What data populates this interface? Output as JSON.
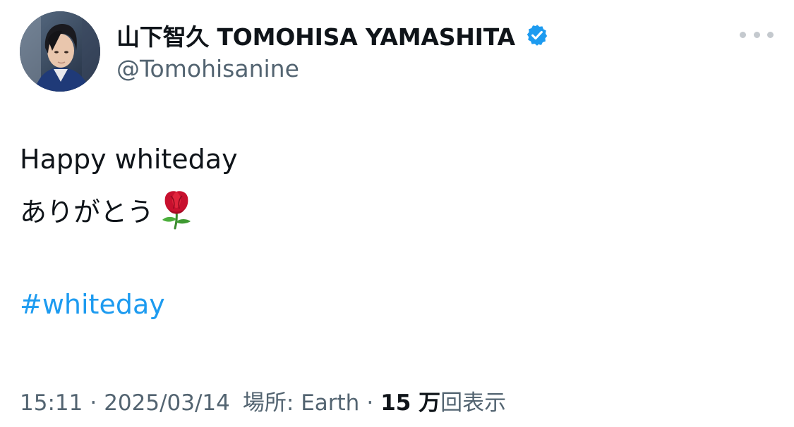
{
  "author": {
    "display_name": "山下智久 TOMOHISA YAMASHITA",
    "handle": "@Tomohisanine",
    "verified_icon": "verified-badge-icon",
    "avatar": "profile-photo"
  },
  "tweet": {
    "line1": "Happy whiteday",
    "line2": "ありがとう",
    "emoji": "rose",
    "hashtag": "#whiteday"
  },
  "meta": {
    "time": "15:11",
    "separator": "·",
    "date": "2025/03/14",
    "location": "場所: Earth",
    "views_count": "15 万",
    "views_label": "回表示"
  },
  "colors": {
    "text": "#0f1419",
    "secondary": "#536471",
    "link": "#1d9bf0",
    "verified": "#1d9bf0"
  },
  "more_menu_icon": "ellipsis-icon"
}
